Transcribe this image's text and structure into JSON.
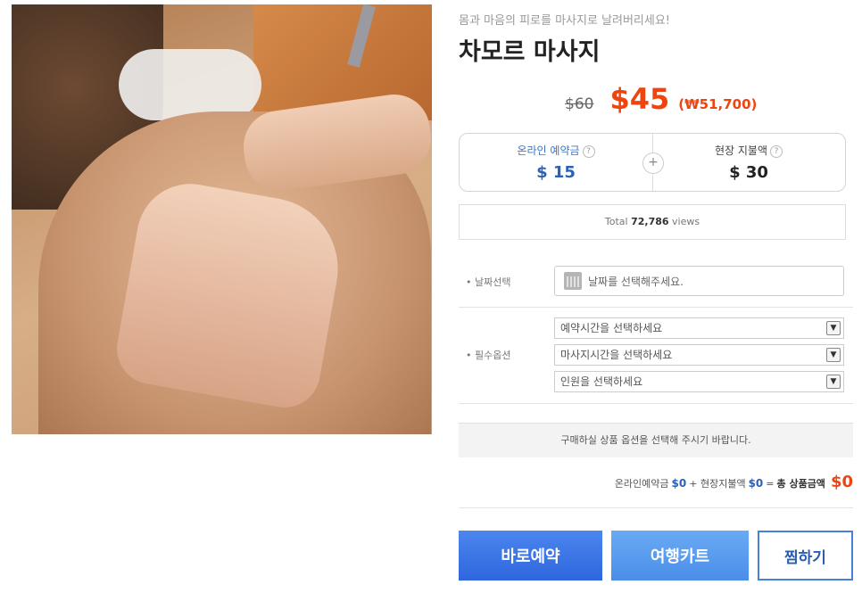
{
  "product": {
    "subtitle": "몸과 마음의 피로를 마사지로 날려버리세요!",
    "title": "차모르 마사지",
    "image_alt": "back-massage-photo"
  },
  "price": {
    "original": "$60",
    "sale": "$45",
    "krw": "(₩51,700)"
  },
  "payment": {
    "online_label": "온라인 예약금",
    "online_value": "$ 15",
    "plus": "+",
    "onsite_label": "현장 지불액",
    "onsite_value": "$ 30",
    "help": "?"
  },
  "views": {
    "prefix": "Total",
    "count": "72,786",
    "suffix": "views"
  },
  "options": {
    "date_label": "• 날짜선택",
    "date_placeholder": "날짜를 선택해주세요.",
    "required_label": "• 필수옵션",
    "selects": [
      "예약시간을 선택하세요",
      "마사지시간을 선택하세요",
      "인원을 선택하세요"
    ],
    "arrow": "▼"
  },
  "notice": "구매하실 상품 옵션을 선택해 주시기 바랍니다.",
  "summary": {
    "online_label": "온라인예약금",
    "online_value": "$0",
    "plus": "+",
    "onsite_label": "현장지불액",
    "onsite_value": "$0",
    "equals": "=",
    "total_label": "총 상품금액",
    "total_value": "$0"
  },
  "buttons": {
    "book": "바로예약",
    "cart": "여행카트",
    "wish": "찜하기"
  },
  "colors": {
    "accent_red": "#ee4510",
    "accent_blue": "#2e66de"
  }
}
